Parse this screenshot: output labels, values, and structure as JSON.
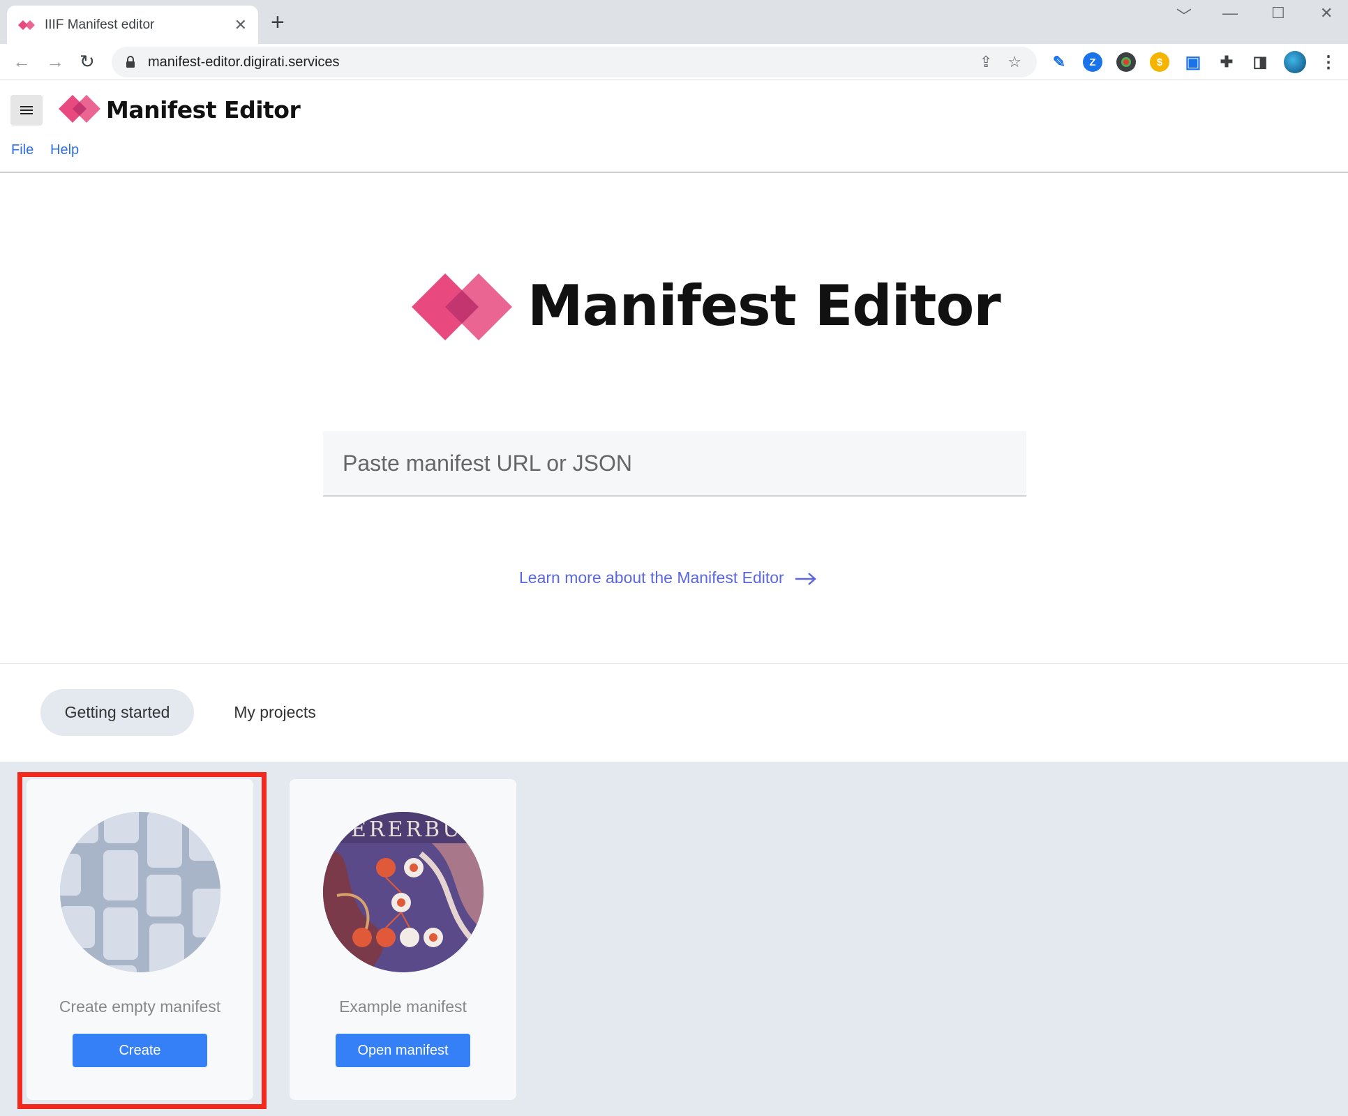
{
  "browser": {
    "tab_title": "IIIF Manifest editor",
    "tab_close": "✕",
    "new_tab": "+",
    "url": "manifest-editor.digirati.services",
    "back": "←",
    "forward": "→",
    "reload": "↻",
    "window_controls": [
      "﹀",
      "—",
      "☐",
      "✕"
    ],
    "extensions": [
      {
        "name": "hammer-extension-icon",
        "glyph": "✎",
        "color": "#1a73e8"
      },
      {
        "name": "zotero-extension-icon",
        "glyph": "Z",
        "color": "#1a73e8"
      },
      {
        "name": "color-extension-icon",
        "glyph": "●",
        "color": "#3c4043"
      },
      {
        "name": "coin-extension-icon",
        "glyph": "$",
        "color": "#f4b400"
      },
      {
        "name": "bookmark-extension-icon",
        "glyph": "▣",
        "color": "#1a73e8"
      }
    ]
  },
  "app": {
    "name": "Manifest Editor",
    "menu": [
      "File",
      "Help"
    ]
  },
  "hero": {
    "title": "Manifest Editor",
    "search_placeholder": "Paste manifest URL or JSON",
    "learn_more": "Learn more about the Manifest Editor"
  },
  "tabs": [
    {
      "label": "Getting started",
      "active": true
    },
    {
      "label": "My projects",
      "active": false
    }
  ],
  "cards": [
    {
      "label": "Create empty manifest",
      "button": "Create"
    },
    {
      "label": "Example manifest",
      "button": "Open manifest"
    }
  ],
  "colors": {
    "brand_pink": "#e84a7f",
    "button_blue": "#3680f7",
    "link_blue": "#2f6fdf",
    "highlight_red": "#f4291e"
  }
}
